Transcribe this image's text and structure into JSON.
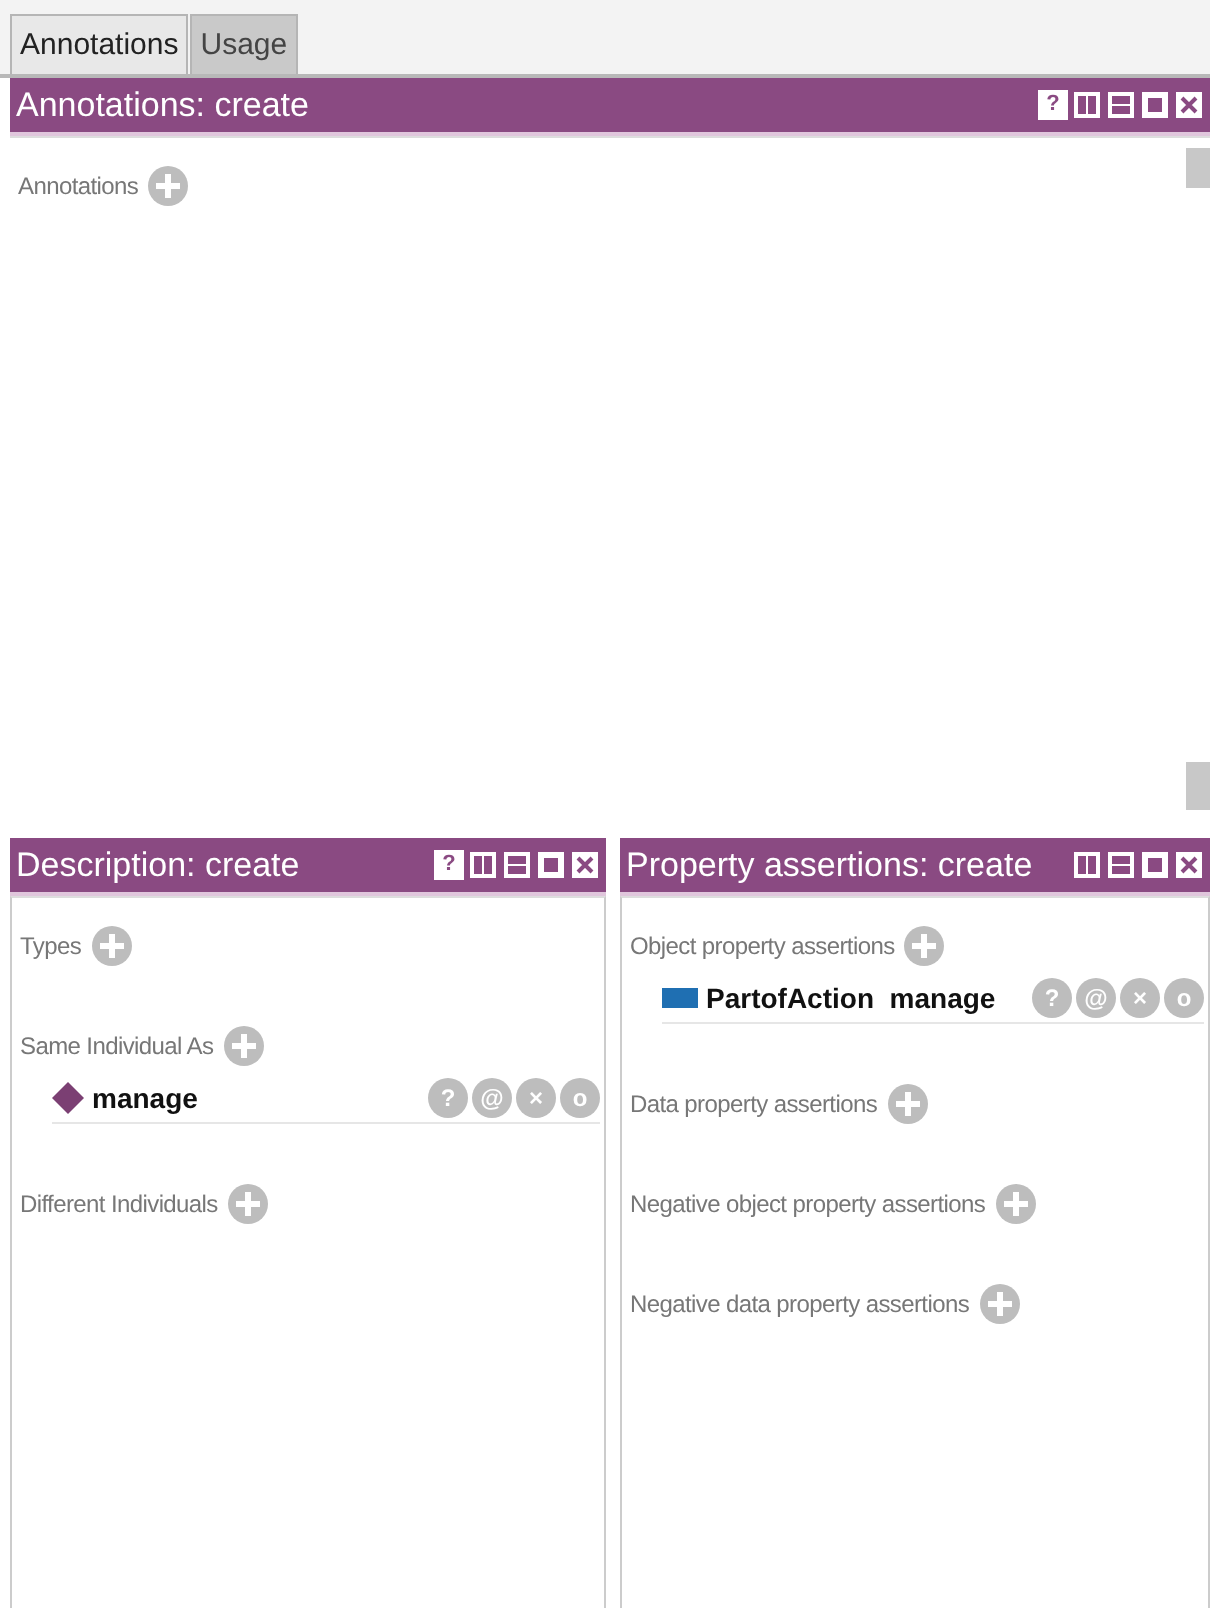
{
  "tabs": [
    {
      "label": "Annotations",
      "selected": true
    },
    {
      "label": "Usage",
      "selected": false
    }
  ],
  "annotations_view": {
    "title": "Annotations: create",
    "buttons": [
      {
        "kind": "help",
        "label": "?"
      },
      {
        "kind": "split-vertical"
      },
      {
        "kind": "split-horizontal"
      },
      {
        "kind": "maximize"
      },
      {
        "kind": "close"
      }
    ],
    "sections": [
      {
        "label": "Annotations"
      }
    ]
  },
  "description_view": {
    "title": "Description: create",
    "buttons": [
      {
        "kind": "help",
        "label": "?"
      },
      {
        "kind": "split-vertical"
      },
      {
        "kind": "split-horizontal"
      },
      {
        "kind": "maximize"
      },
      {
        "kind": "close"
      }
    ],
    "sections": [
      {
        "label": "Types"
      },
      {
        "label": "Same Individual As",
        "items": [
          {
            "kind": "individual",
            "text": "manage",
            "actions": [
              "?",
              "@",
              "×",
              "o"
            ]
          }
        ]
      },
      {
        "label": "Different Individuals"
      }
    ]
  },
  "property_view": {
    "title": "Property assertions: create",
    "buttons": [
      {
        "kind": "split-vertical"
      },
      {
        "kind": "split-horizontal"
      },
      {
        "kind": "maximize"
      },
      {
        "kind": "close"
      }
    ],
    "sections": [
      {
        "label": "Object property assertions",
        "items": [
          {
            "kind": "object-property",
            "text": "PartofAction  manage",
            "actions": [
              "?",
              "@",
              "×",
              "o"
            ]
          }
        ]
      },
      {
        "label": "Data property assertions"
      },
      {
        "label": "Negative object property assertions"
      },
      {
        "label": "Negative data property assertions"
      }
    ]
  }
}
